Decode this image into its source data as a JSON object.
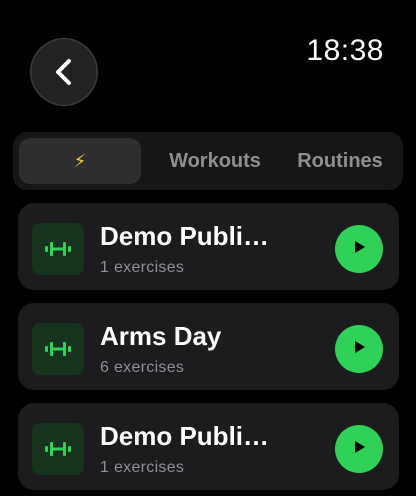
{
  "status": {
    "time": "18:38"
  },
  "nav": {
    "back_icon": "chevron-left-icon"
  },
  "tabs": [
    {
      "label": "⚡",
      "icon": "lightning-bolt-icon",
      "selected": true
    },
    {
      "label": "Workouts",
      "selected": false
    },
    {
      "label": "Routines",
      "selected": false
    }
  ],
  "workouts": [
    {
      "title": "Demo Publi…",
      "subtitle": "1 exercises",
      "icon": "dumbbell-icon",
      "action_icon": "play-icon"
    },
    {
      "title": "Arms Day",
      "subtitle": "6 exercises",
      "icon": "dumbbell-icon",
      "action_icon": "play-icon"
    },
    {
      "title": "Demo Publi…",
      "subtitle": "1 exercises",
      "icon": "dumbbell-icon",
      "action_icon": "play-icon"
    }
  ],
  "colors": {
    "background": "#000000",
    "card": "#1c1c1e",
    "accent_green": "#30d158",
    "icon_tile": "#16331e",
    "secondary_text": "#8e8e93",
    "bolt_yellow": "#f2c94c"
  }
}
